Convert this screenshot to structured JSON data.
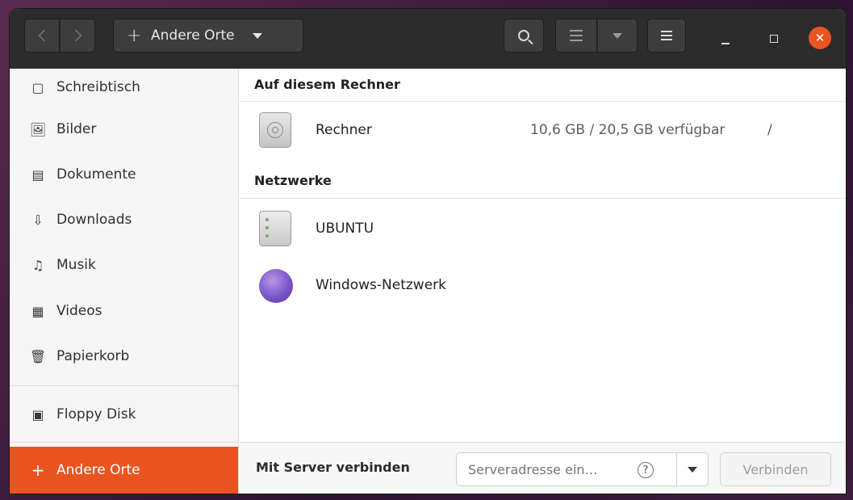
{
  "window": {
    "path_label": "Andere Orte",
    "accent_color": "#e95420"
  },
  "headerbar": {
    "back_icon": "chevron-left-icon",
    "forward_icon": "chevron-right-icon",
    "path_plus": "+",
    "search_icon": "search-icon",
    "view_icon": "list-view-icon",
    "menu_icon": "hamburger-menu-icon",
    "close_glyph": "✕"
  },
  "sidebar": {
    "items": [
      {
        "label": "Schreibtisch",
        "icon": "desktop-icon",
        "glyph": "▢"
      },
      {
        "label": "Bilder",
        "icon": "image-icon",
        "glyph": "🖼"
      },
      {
        "label": "Dokumente",
        "icon": "document-icon",
        "glyph": "▤"
      },
      {
        "label": "Downloads",
        "icon": "download-icon",
        "glyph": "⇩"
      },
      {
        "label": "Musik",
        "icon": "music-icon",
        "glyph": "♫"
      },
      {
        "label": "Videos",
        "icon": "video-icon",
        "glyph": "▦"
      },
      {
        "label": "Papierkorb",
        "icon": "trash-icon",
        "glyph": "🗑"
      },
      {
        "label": "Floppy Disk",
        "icon": "floppy-disk-icon",
        "glyph": "▣"
      },
      {
        "label": "Andere Orte",
        "icon": "plus-icon",
        "glyph": "+"
      }
    ]
  },
  "main": {
    "section_computer": "Auf diesem Rechner",
    "computer": {
      "name": "Rechner",
      "info": "10,6 GB / 20,5 GB verfügbar",
      "path": "/"
    },
    "section_networks": "Netzwerke",
    "networks": [
      {
        "name": "UBUNTU",
        "icon": "server-icon"
      },
      {
        "name": "Windows-Netzwerk",
        "icon": "network-globe-icon"
      }
    ]
  },
  "connect": {
    "label": "Mit Server verbinden",
    "placeholder": "Serveradresse ein…",
    "help_glyph": "?",
    "button_label": "Verbinden"
  }
}
